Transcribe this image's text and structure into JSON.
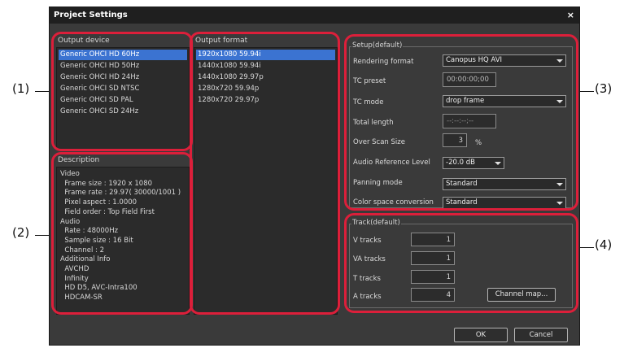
{
  "dialog": {
    "title": "Project Settings",
    "close_label": "×"
  },
  "output_device": {
    "label": "Output device",
    "items": [
      "Generic OHCI HD 60Hz",
      "Generic OHCI HD 50Hz",
      "Generic OHCI HD 24Hz",
      "Generic OHCI SD NTSC",
      "Generic OHCI SD PAL",
      "Generic OHCI SD 24Hz"
    ],
    "selected_index": 0
  },
  "output_format": {
    "label": "Output format",
    "items": [
      "1920x1080 59.94i",
      "1440x1080 59.94i",
      "1440x1080 29.97p",
      "1280x720 59.94p",
      "1280x720 29.97p"
    ],
    "selected_index": 0
  },
  "description": {
    "label": "Description",
    "lines": [
      "Video",
      "  Frame size : 1920 x 1080",
      "  Frame rate : 29.97( 30000/1001 )",
      "  Pixel aspect : 1.0000",
      "  Field order : Top Field First",
      "Audio",
      "  Rate : 48000Hz",
      "  Sample size : 16 Bit",
      "  Channel : 2",
      "Additional Info",
      "  AVCHD",
      "  Infinity",
      "  HD D5, AVC-Intra100",
      "  HDCAM-SR"
    ]
  },
  "setup": {
    "title": "Setup(default)",
    "rendering_format": {
      "label": "Rendering format",
      "value": "Canopus HQ AVI"
    },
    "tc_preset": {
      "label": "TC preset",
      "value": "00:00:00;00"
    },
    "tc_mode": {
      "label": "TC mode",
      "value": "drop frame"
    },
    "total_length": {
      "label": "Total length",
      "value": "--:--:--;--"
    },
    "over_scan": {
      "label": "Over Scan Size",
      "value": "3",
      "unit": "%"
    },
    "audio_ref": {
      "label": "Audio Reference Level",
      "value": "-20.0 dB"
    },
    "panning_mode": {
      "label": "Panning mode",
      "value": "Standard"
    },
    "color_space": {
      "label": "Color space conversion",
      "value": "Standard"
    }
  },
  "track": {
    "title": "Track(default)",
    "rows": [
      {
        "label": "V tracks",
        "value": "1"
      },
      {
        "label": "VA tracks",
        "value": "1"
      },
      {
        "label": "T tracks",
        "value": "1"
      },
      {
        "label": "A tracks",
        "value": "4"
      }
    ],
    "channel_map_label": "Channel map..."
  },
  "footer": {
    "ok_label": "OK",
    "cancel_label": "Cancel"
  },
  "callouts": {
    "c1": "(1)",
    "c2": "(2)",
    "c3": "(3)",
    "c4": "(4)"
  },
  "colors": {
    "highlight": "#dc1f3a",
    "selection": "#3b73d1",
    "dialog_bg": "#3a3a3a"
  }
}
